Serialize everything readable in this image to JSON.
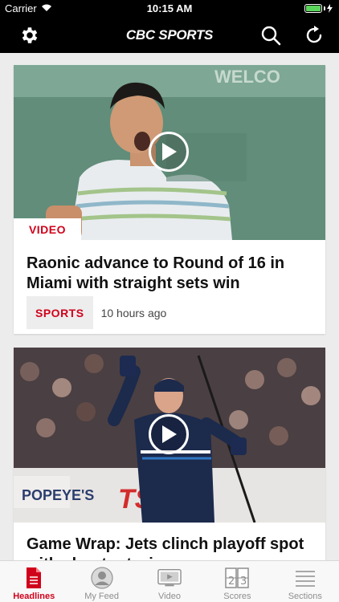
{
  "status_bar": {
    "carrier": "Carrier",
    "time": "10:15 AM"
  },
  "nav": {
    "logo": "CBC SPORTS",
    "icons": [
      "gear-icon",
      "search-icon",
      "refresh-icon"
    ]
  },
  "colors": {
    "accent": "#d0021b",
    "nav_bg": "#000000",
    "card_bg": "#ffffff",
    "feed_bg": "#ececec"
  },
  "feed": {
    "cards": [
      {
        "tag": "VIDEO",
        "headline": "Raonic advance to Round of 16 in Miami with straight sets win",
        "category": "SPORTS",
        "time_ago": "10 hours ago"
      },
      {
        "headline": "Game Wrap: Jets clinch playoff spot with shootout win"
      }
    ]
  },
  "tab_bar": {
    "tabs": [
      {
        "label": "Headlines",
        "icon": "document-icon",
        "active": true
      },
      {
        "label": "My Feed",
        "icon": "person-icon",
        "active": false
      },
      {
        "label": "Video",
        "icon": "tv-icon",
        "active": false
      },
      {
        "label": "Scores",
        "icon": "scoreboard-icon",
        "active": false
      },
      {
        "label": "Sections",
        "icon": "menu-lines-icon",
        "active": false
      }
    ]
  }
}
